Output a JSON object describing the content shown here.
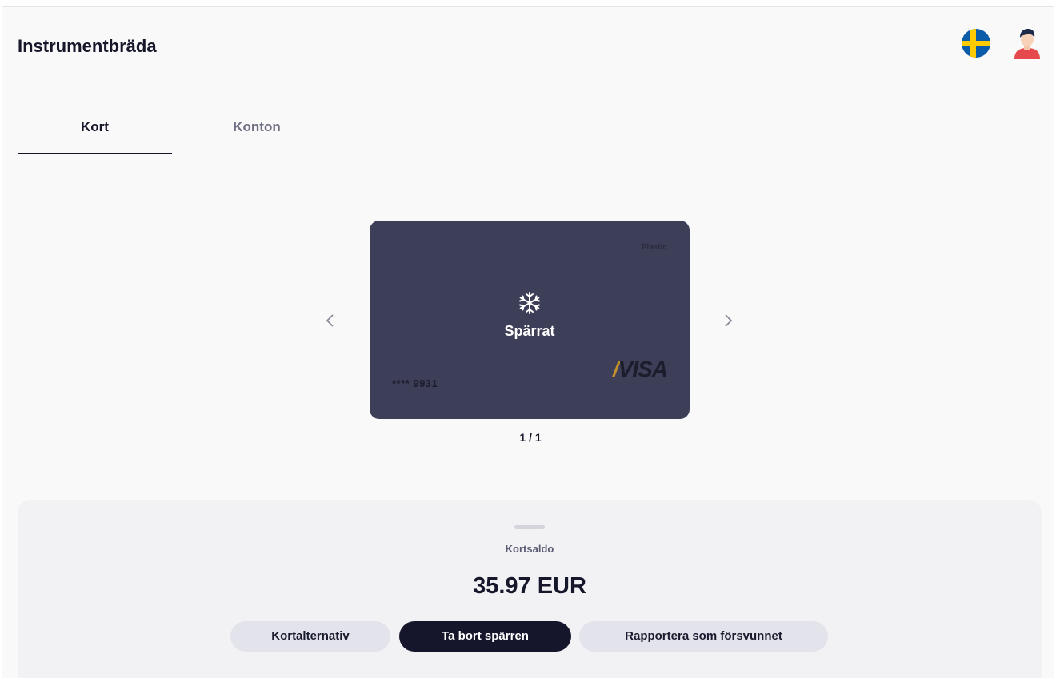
{
  "header": {
    "title": "Instrumentbräda",
    "language_icon": "flag-sweden-icon",
    "profile_icon": "user-avatar-icon"
  },
  "tabs": [
    {
      "label": "Kort",
      "active": true
    },
    {
      "label": "Konton",
      "active": false
    }
  ],
  "card": {
    "type_label": "Plastic",
    "status_icon": "snowflake-icon",
    "status_label": "Spärrat",
    "masked_number": "**** 9931",
    "brand": "VISA"
  },
  "carousel": {
    "prev_icon": "chevron-left-icon",
    "next_icon": "chevron-right-icon",
    "pager": "1 / 1"
  },
  "balance": {
    "label": "Kortsaldo",
    "value": "35.97 EUR"
  },
  "actions": {
    "options_label": "Kortalternativ",
    "unblock_label": "Ta bort spärren",
    "report_lost_label": "Rapportera som försvunnet"
  },
  "colors": {
    "primary": "#15162b",
    "card": "#3d3e57",
    "flag_blue": "#0a5ba8",
    "flag_yellow": "#fecb00"
  }
}
